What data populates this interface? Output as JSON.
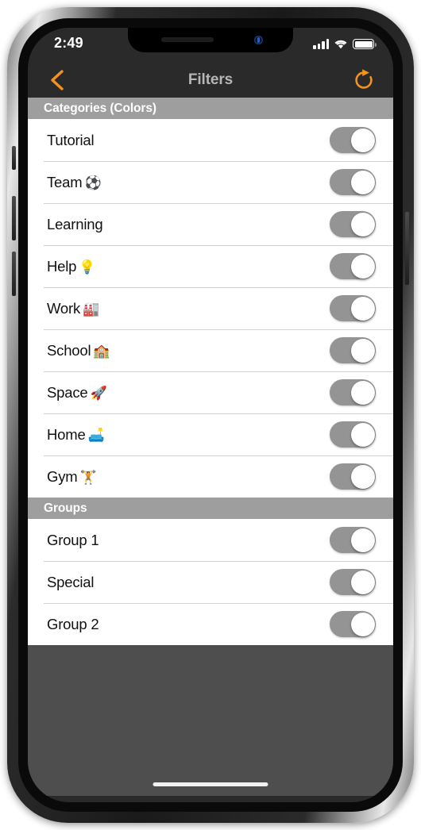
{
  "device": {
    "frame_color": "#1a1a1a",
    "screen_background": "#4e4e4e"
  },
  "status_bar": {
    "time": "2:49",
    "signal_icon": "cellular-signal-icon",
    "wifi_icon": "wifi-icon",
    "battery_icon": "battery-full-icon"
  },
  "nav_bar": {
    "title": "Filters",
    "back_icon": "back-chevron-icon",
    "refresh_icon": "refresh-icon",
    "accent_color": "#f5921e",
    "title_color": "#b6b6b6",
    "background_color": "#2a2a2a"
  },
  "sections": [
    {
      "header": "Categories (Colors)",
      "rows": [
        {
          "label": "Tutorial",
          "emoji": "",
          "toggle_on": true
        },
        {
          "label": "Team",
          "emoji": "⚽",
          "toggle_on": true
        },
        {
          "label": "Learning",
          "emoji": "",
          "toggle_on": true
        },
        {
          "label": "Help",
          "emoji": "💡",
          "toggle_on": true
        },
        {
          "label": "Work",
          "emoji": "🏭",
          "toggle_on": true
        },
        {
          "label": "School",
          "emoji": "🏫",
          "toggle_on": true
        },
        {
          "label": "Space",
          "emoji": "🚀",
          "toggle_on": true
        },
        {
          "label": "Home",
          "emoji": "🛋️",
          "toggle_on": true
        },
        {
          "label": "Gym",
          "emoji": "🏋️",
          "toggle_on": true
        }
      ]
    },
    {
      "header": "Groups",
      "rows": [
        {
          "label": "Group 1",
          "emoji": "",
          "toggle_on": true
        },
        {
          "label": "Special",
          "emoji": "",
          "toggle_on": true
        },
        {
          "label": "Group 2",
          "emoji": "",
          "toggle_on": true
        }
      ]
    }
  ],
  "colors": {
    "section_header_bg": "#9e9e9e",
    "row_bg": "#ffffff",
    "separator": "#d3d3d3",
    "toggle_track": "#949494",
    "toggle_knob": "#ffffff"
  }
}
